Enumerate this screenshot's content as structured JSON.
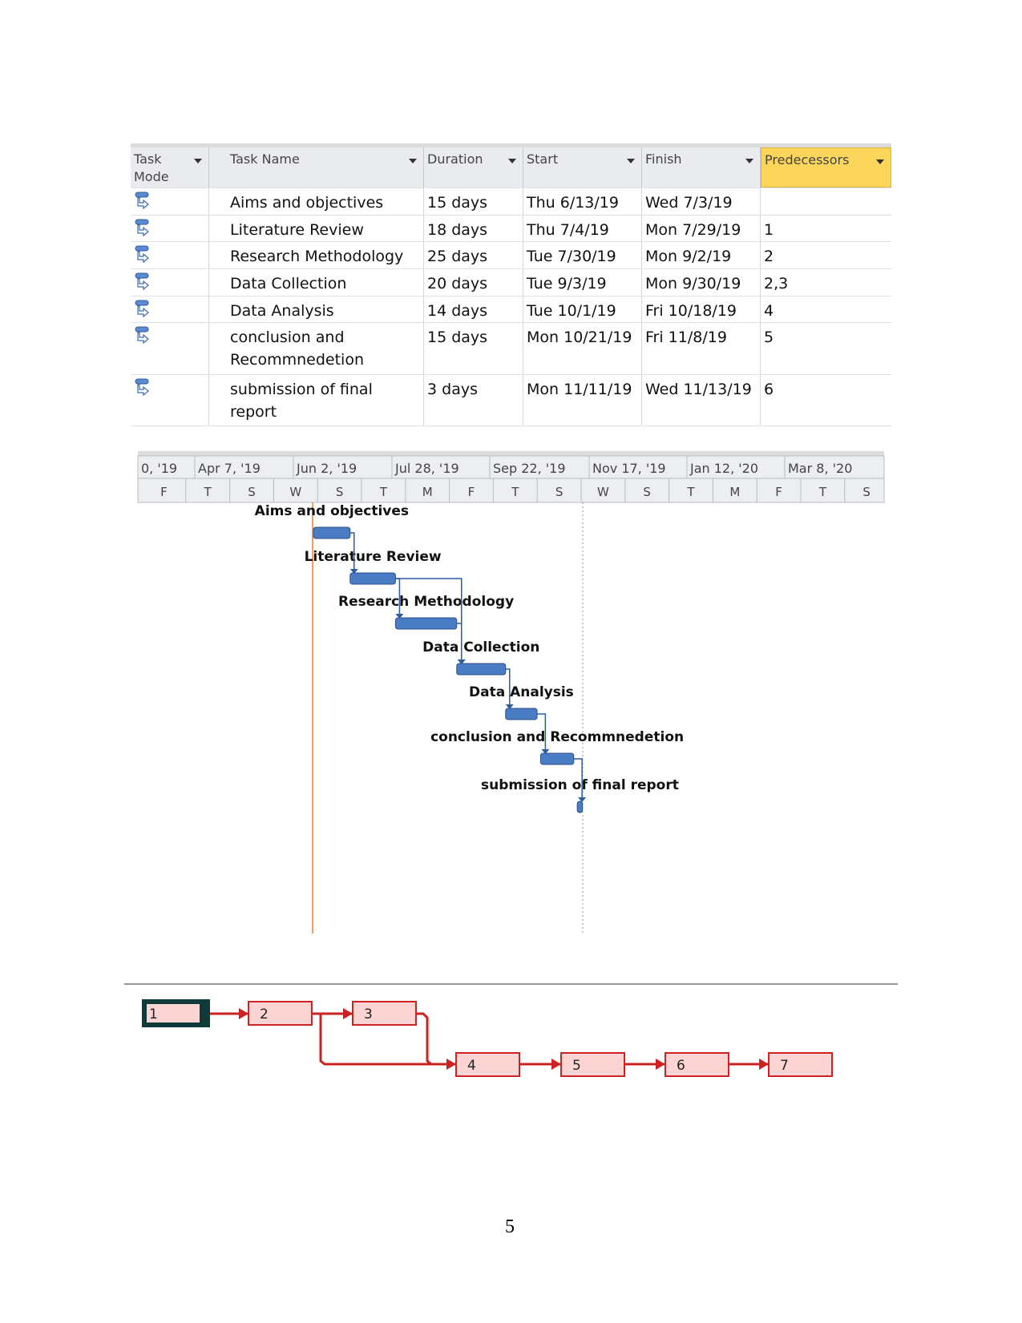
{
  "table": {
    "columns": [
      "Task Mode",
      "Task Name",
      "Duration",
      "Start",
      "Finish",
      "Predecessors"
    ],
    "rows": [
      {
        "mode": "auto-scheduled-icon",
        "name": "Aims and objectives",
        "duration": "15 days",
        "start": "Thu 6/13/19",
        "finish": "Wed 7/3/19",
        "pred": ""
      },
      {
        "mode": "auto-scheduled-icon",
        "name": "Literature Review",
        "duration": "18 days",
        "start": "Thu 7/4/19",
        "finish": "Mon 7/29/19",
        "pred": "1"
      },
      {
        "mode": "auto-scheduled-icon",
        "name": "Research Methodology",
        "duration": "25 days",
        "start": "Tue 7/30/19",
        "finish": "Mon 9/2/19",
        "pred": "2"
      },
      {
        "mode": "auto-scheduled-icon",
        "name": "Data Collection",
        "duration": "20 days",
        "start": "Tue 9/3/19",
        "finish": "Mon 9/30/19",
        "pred": "2,3"
      },
      {
        "mode": "auto-scheduled-icon",
        "name": "Data Analysis",
        "duration": "14 days",
        "start": "Tue 10/1/19",
        "finish": "Fri 10/18/19",
        "pred": "4"
      },
      {
        "mode": "auto-scheduled-icon",
        "name": "conclusion and Recommnedetion",
        "duration": "15 days",
        "start": "Mon 10/21/19",
        "finish": "Fri 11/8/19",
        "pred": "5"
      },
      {
        "mode": "auto-scheduled-icon",
        "name": "submission of final report",
        "duration": "3 days",
        "start": "Mon 11/11/19",
        "finish": "Wed 11/13/19",
        "pred": "6"
      }
    ]
  },
  "gantt": {
    "top_tier": [
      "0, '19",
      "Apr 7, '19",
      "Jun 2, '19",
      "Jul 28, '19",
      "Sep 22, '19",
      "Nov 17, '19",
      "Jan 12, '20",
      "Mar 8, '20"
    ],
    "bottom_tier": [
      "F",
      "T",
      "S",
      "W",
      "S",
      "T",
      "M",
      "F",
      "T",
      "S",
      "W",
      "S",
      "T",
      "M",
      "F",
      "T",
      "S"
    ],
    "tasks": [
      {
        "label": "Aims and objectives",
        "start": "2019-06-13",
        "finish": "2019-07-03",
        "pred": []
      },
      {
        "label": "Literature Review",
        "start": "2019-07-04",
        "finish": "2019-07-29",
        "pred": [
          1
        ]
      },
      {
        "label": "Research Methodology",
        "start": "2019-07-30",
        "finish": "2019-09-02",
        "pred": [
          2
        ]
      },
      {
        "label": "Data Collection",
        "start": "2019-09-03",
        "finish": "2019-09-30",
        "pred": [
          2,
          3
        ]
      },
      {
        "label": "Data Analysis",
        "start": "2019-10-01",
        "finish": "2019-10-18",
        "pred": [
          4
        ]
      },
      {
        "label": "conclusion and Recommnedetion",
        "start": "2019-10-21",
        "finish": "2019-11-08",
        "pred": [
          5
        ]
      },
      {
        "label": "submission of final report",
        "start": "2019-11-11",
        "finish": "2019-11-13",
        "pred": [
          6
        ]
      }
    ],
    "colors": {
      "bar": "#4a7cc4",
      "link": "#2d5c9e",
      "today": "#f0a060"
    }
  },
  "network": {
    "nodes": [
      "1",
      "2",
      "3",
      "4",
      "5",
      "6",
      "7"
    ],
    "colors": {
      "fill": "#fdd4d4",
      "stroke": "#cc2222",
      "selected": "#0f3a3a"
    }
  },
  "page_number": "5"
}
